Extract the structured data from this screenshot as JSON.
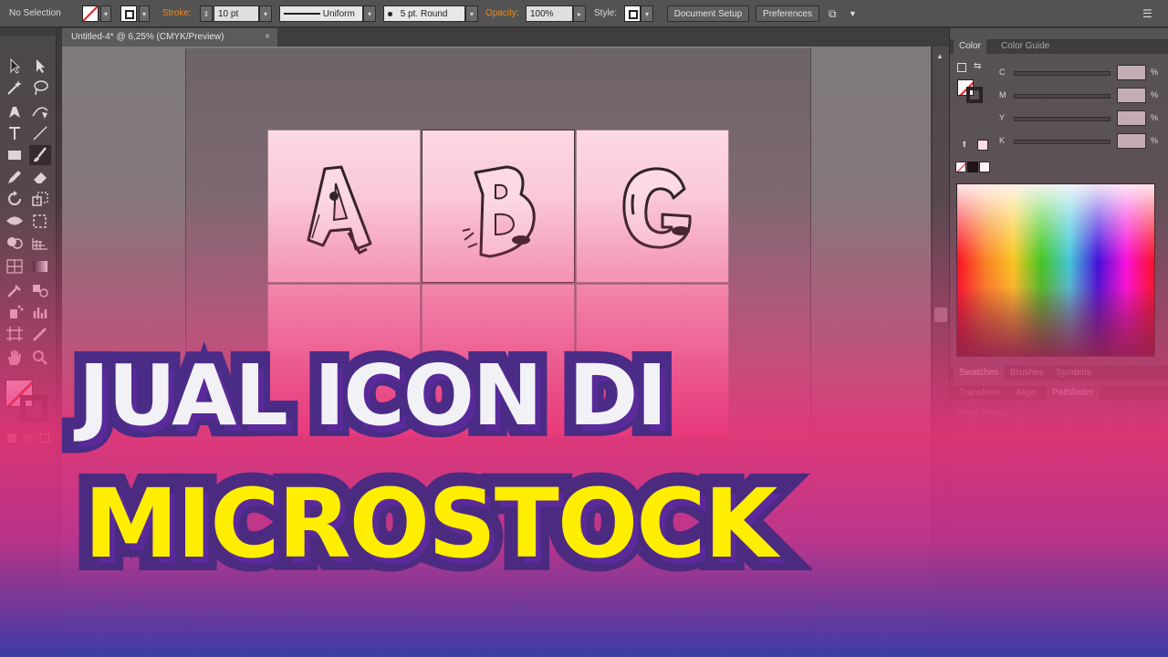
{
  "control_bar": {
    "selection_label": "No Selection",
    "stroke_label": "Stroke:",
    "stroke_weight": "10 pt",
    "profile": "Uniform",
    "brush": "5 pt. Round",
    "opacity_label": "Opacity:",
    "opacity_value": "100%",
    "style_label": "Style:",
    "document_setup": "Document Setup",
    "preferences": "Preferences"
  },
  "document": {
    "tab_title": "Untitled-4* @ 6,25% (CMYK/Preview)",
    "tab_close": "×",
    "icons": [
      "A",
      "B",
      "G"
    ]
  },
  "color_panel": {
    "tabs": [
      "Color",
      "Color Guide"
    ],
    "channels": [
      {
        "label": "C",
        "unit": "%"
      },
      {
        "label": "M",
        "unit": "%"
      },
      {
        "label": "Y",
        "unit": "%"
      },
      {
        "label": "K",
        "unit": "%"
      }
    ]
  },
  "lower_panels": {
    "tabs_1": [
      "Swatches",
      "Brushes",
      "Symbols"
    ],
    "tabs_2": [
      "Transform",
      "Align",
      "Pathfinder"
    ],
    "shape_modes": "Shape Modes:",
    "pathfinders": "Pathfinders:"
  },
  "promo": {
    "line1": "JUAL ICON DI",
    "line2": "MICROSTOCK"
  },
  "colors": {
    "accent_orange": "#f08a1c",
    "promo_white": "#f2f2f6",
    "promo_yellow": "#ffee00",
    "promo_outline": "#4a2c86",
    "gradient_pink": "#ec3c82",
    "gradient_blue": "#3c3ca5"
  }
}
